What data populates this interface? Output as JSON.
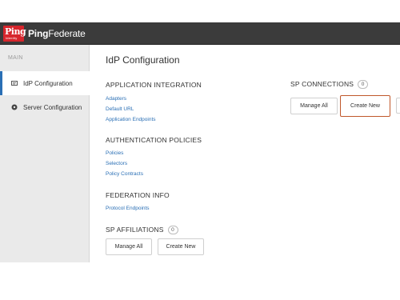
{
  "brand": {
    "logo_word": "Ping",
    "logo_sub": "Identity",
    "product_prefix": "Ping",
    "product_suffix": "Federate",
    "accent": "#d7262d"
  },
  "sidebar": {
    "section_label": "MAIN",
    "items": [
      {
        "label": "IdP Configuration",
        "icon": "idp-card-icon",
        "active": true
      },
      {
        "label": "Server Configuration",
        "icon": "server-disc-icon",
        "active": false
      }
    ]
  },
  "main": {
    "title": "IdP Configuration",
    "application_integration": {
      "heading": "APPLICATION INTEGRATION",
      "links": [
        "Adapters",
        "Default URL",
        "Application Endpoints"
      ]
    },
    "authentication_policies": {
      "heading": "AUTHENTICATION POLICIES",
      "links": [
        "Policies",
        "Selectors",
        "Policy Contracts"
      ]
    },
    "federation_info": {
      "heading": "FEDERATION INFO",
      "links": [
        "Protocol Endpoints"
      ]
    },
    "sp_affiliations": {
      "heading": "SP AFFILIATIONS",
      "count": "0",
      "manage_all": "Manage All",
      "create_new": "Create New"
    },
    "sp_connections": {
      "heading": "SP CONNECTIONS",
      "count": "0",
      "manage_all": "Manage All",
      "create_new": "Create New"
    }
  },
  "colors": {
    "link": "#2a6fb5",
    "highlight": "#c0572b",
    "topbar": "#3b3b3b"
  }
}
